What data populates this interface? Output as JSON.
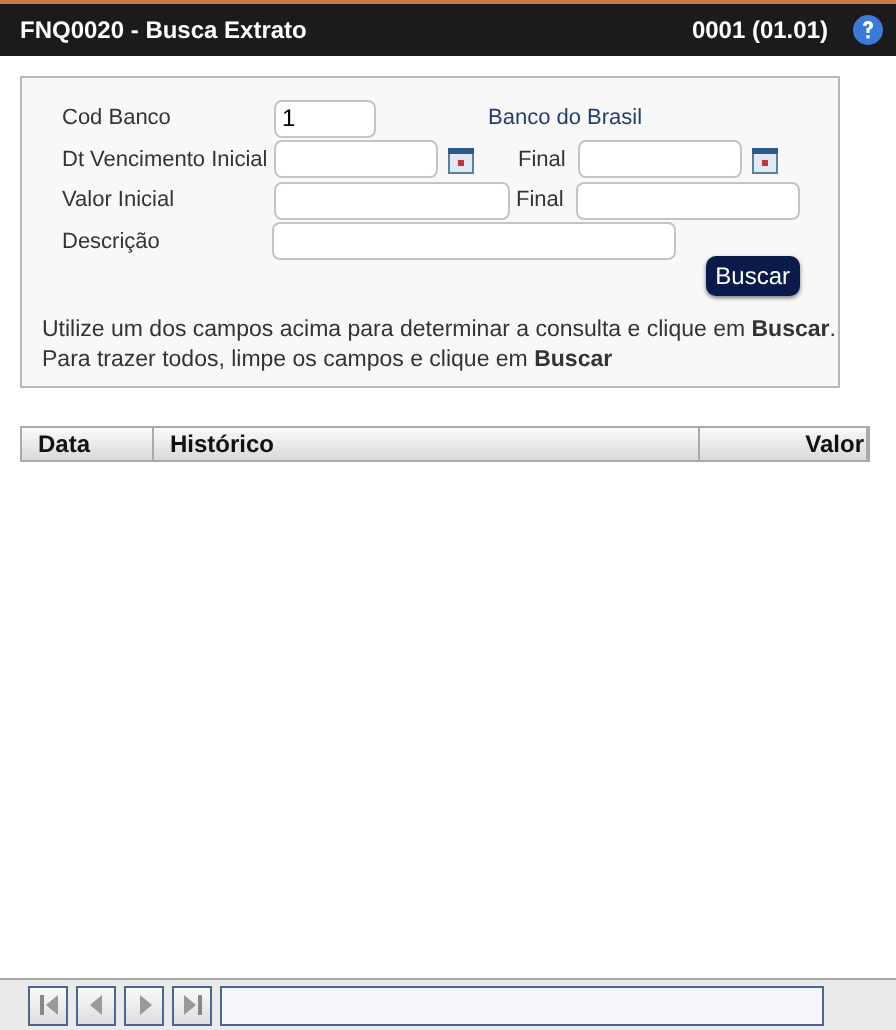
{
  "header": {
    "title": "FNQ0020 - Busca Extrato",
    "version": "0001 (01.01)"
  },
  "form": {
    "cod_banco": {
      "label": "Cod Banco",
      "value": "1",
      "bank_name": "Banco do Brasil"
    },
    "dt_vencimento": {
      "label": "Dt Vencimento Inicial",
      "final_label": "Final"
    },
    "valor": {
      "label": "Valor Inicial",
      "final_label": "Final"
    },
    "descricao": {
      "label": "Descrição"
    },
    "search_button": "Buscar",
    "hint": [
      "Utilize um dos campos acima para determinar a consulta e clique em **Buscar**.",
      "Para trazer todos, limpe os campos e clique em **Buscar**"
    ]
  },
  "table": {
    "columns": [
      "Data",
      "Histórico",
      "Valor"
    ]
  }
}
